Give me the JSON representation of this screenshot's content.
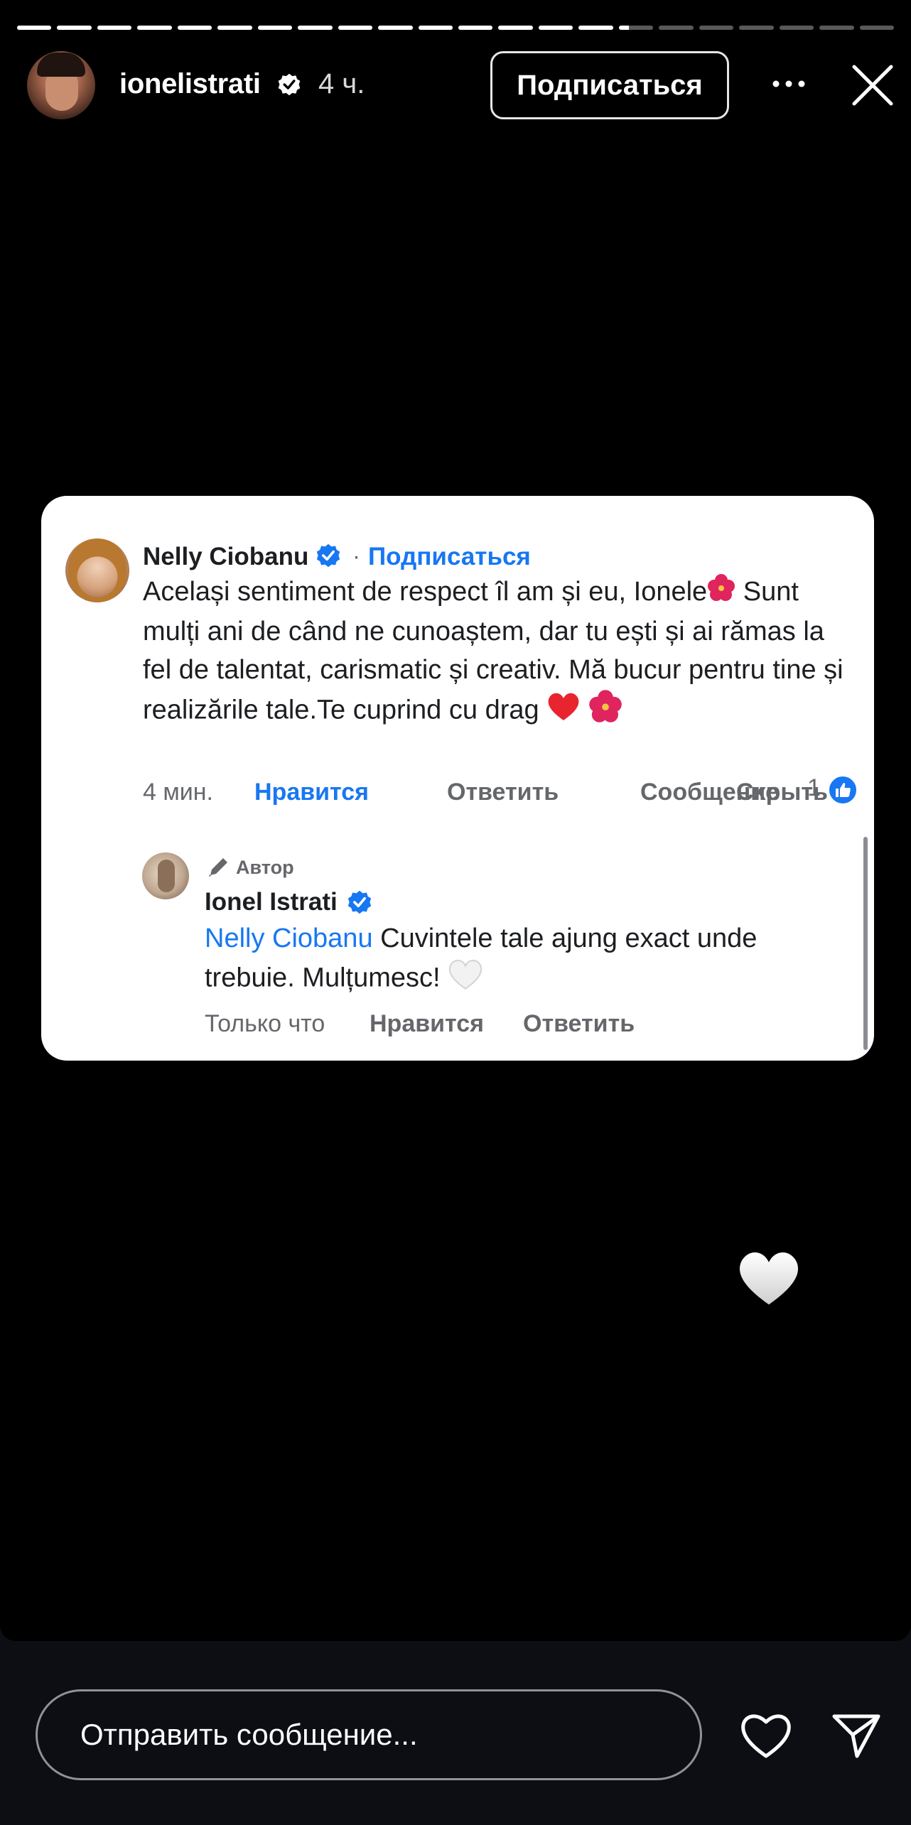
{
  "progress": {
    "segments": 22,
    "completed": 15,
    "current_fill": 0.3
  },
  "header": {
    "username": "ionelistrati",
    "time": "4 ч.",
    "follow_label": "Подписаться"
  },
  "comment": {
    "author": "Nelly Ciobanu",
    "separator": "·",
    "follow_label": "Подписаться",
    "text_line1": "Același sentiment de respect îl am și eu, Ionele",
    "text_rest": "Sunt mulți ani de când ne cunoaștem, dar tu ești și ai rămas la fel de talentat, carismatic și creativ. Mă bucur pentru tine și realizările tale.Te cuprind cu drag",
    "time": "4 мин.",
    "like_label": "Нравится",
    "reply_label": "Ответить",
    "message_label": "Сообщение",
    "hide_label": "Скрыть",
    "like_count": "1"
  },
  "reply": {
    "author_tag": "Автор",
    "author": "Ionel Istrati",
    "mention": "Nelly Ciobanu",
    "text": "Cuvintele tale ajung exact unde trebuie. Mulțumesc!",
    "time": "Только что",
    "like_label": "Нравится",
    "reply_label": "Ответить"
  },
  "footer": {
    "message_placeholder": "Отправить сообщение..."
  },
  "colors": {
    "facebook_blue": "#1877f2",
    "story_bg": "#000000",
    "footer_bg": "#0c0e13"
  }
}
